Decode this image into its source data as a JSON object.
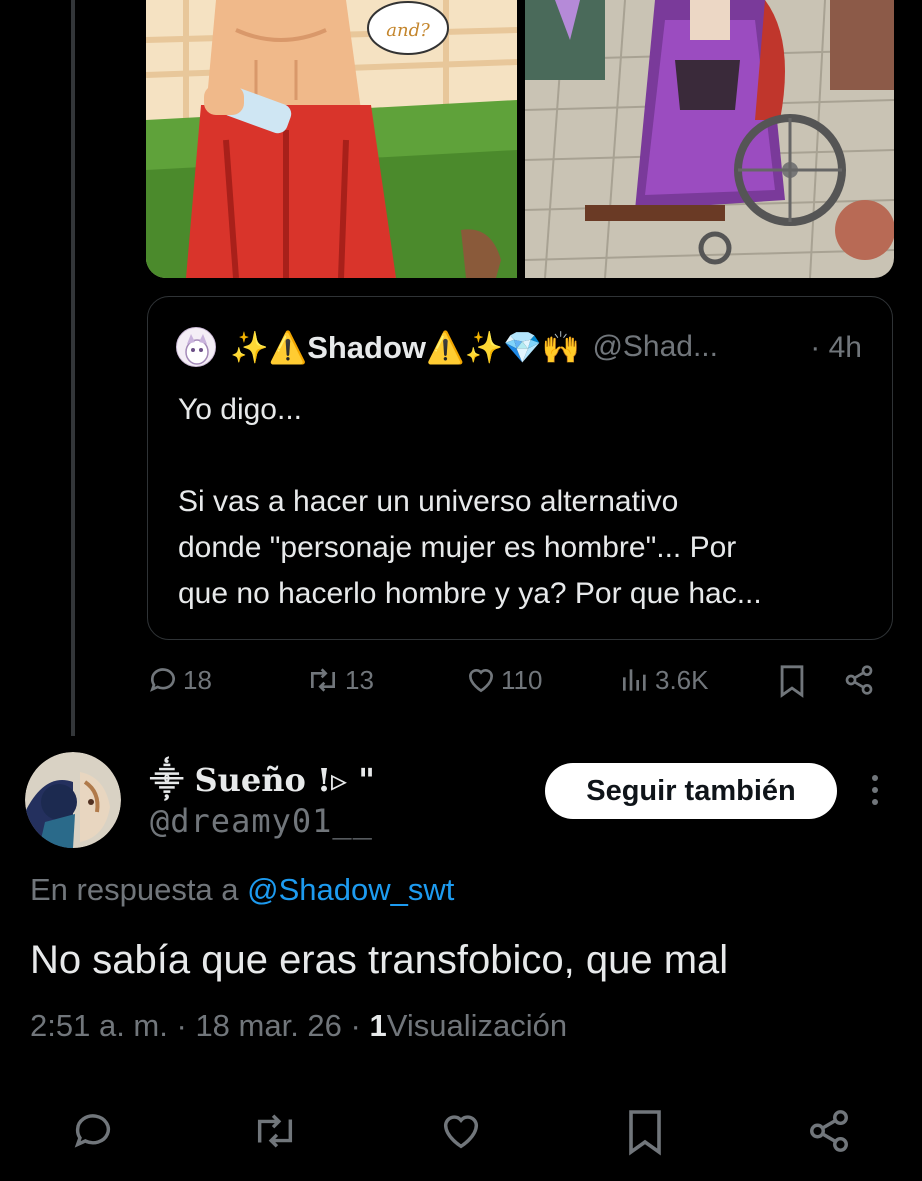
{
  "quoted_post": {
    "author_name": "✨⚠️Shadow⚠️✨💎🙌",
    "author_handle": "@Shad...",
    "time": "· 4h",
    "text_line1": "Yo digo...",
    "text_line2": "Si vas a hacer un universo alternativo",
    "text_line3": "donde \"personaje mujer es hombre\"... Por",
    "text_line4": "que no hacerlo hombre y ya? Por que hac...",
    "speech_bubble": "and?"
  },
  "parent_actions": {
    "replies": "18",
    "reposts": "13",
    "likes": "110",
    "views": "3.6K"
  },
  "reply": {
    "display_name": "⸎ Sueño !▹ \"",
    "handle": "@dreamy01__",
    "follow_label": "Seguir también",
    "reply_prefix": "En respuesta a",
    "reply_mention": "@Shadow_swt",
    "text": "No sabía que eras transfobico, que mal",
    "time": "2:51 a. m.",
    "date": "18 mar. 26",
    "views_count": "1",
    "views_label": "Visualización",
    "separator": "·"
  },
  "icons": {
    "reply": "reply-icon",
    "repost": "repost-icon",
    "like": "heart-icon",
    "views": "views-icon",
    "bookmark": "bookmark-icon",
    "share": "share-icon",
    "more": "more-icon"
  },
  "colors": {
    "background": "#000000",
    "text": "#e7e9ea",
    "muted": "#71767b",
    "link": "#1d9bf0",
    "border": "#2f3336"
  }
}
